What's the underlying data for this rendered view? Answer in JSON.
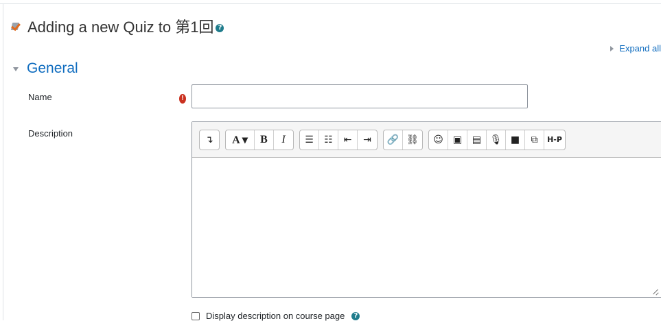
{
  "page": {
    "title": "Adding a new Quiz to 第1回",
    "expand_all": "Expand all"
  },
  "section": {
    "title": "General"
  },
  "form": {
    "name_label": "Name",
    "name_value": "",
    "description_label": "Description",
    "display_description_label": "Display description on course page",
    "display_description_checked": false
  },
  "toolbar": {
    "groups": [
      [
        {
          "icon": "show-more-icon",
          "glyph": "↴"
        }
      ],
      [
        {
          "icon": "font-style-icon",
          "glyph": "A ▾"
        },
        {
          "icon": "bold-icon",
          "glyph": "B"
        },
        {
          "icon": "italic-icon",
          "glyph": "I"
        }
      ],
      [
        {
          "icon": "unordered-list-icon",
          "glyph": "☰"
        },
        {
          "icon": "ordered-list-icon",
          "glyph": "☷"
        },
        {
          "icon": "outdent-icon",
          "glyph": "⇤"
        },
        {
          "icon": "indent-icon",
          "glyph": "⇥"
        }
      ],
      [
        {
          "icon": "link-icon",
          "glyph": "🔗"
        },
        {
          "icon": "unlink-icon",
          "glyph": "⛓"
        }
      ],
      [
        {
          "icon": "emoji-icon",
          "glyph": "☺"
        },
        {
          "icon": "image-icon",
          "glyph": "▣"
        },
        {
          "icon": "media-icon",
          "glyph": "▤"
        },
        {
          "icon": "record-audio-icon",
          "glyph": "🎙"
        },
        {
          "icon": "record-video-icon",
          "glyph": "■"
        },
        {
          "icon": "manage-files-icon",
          "glyph": "⧉"
        },
        {
          "icon": "h5p-icon",
          "glyph": "H-P"
        }
      ]
    ]
  }
}
